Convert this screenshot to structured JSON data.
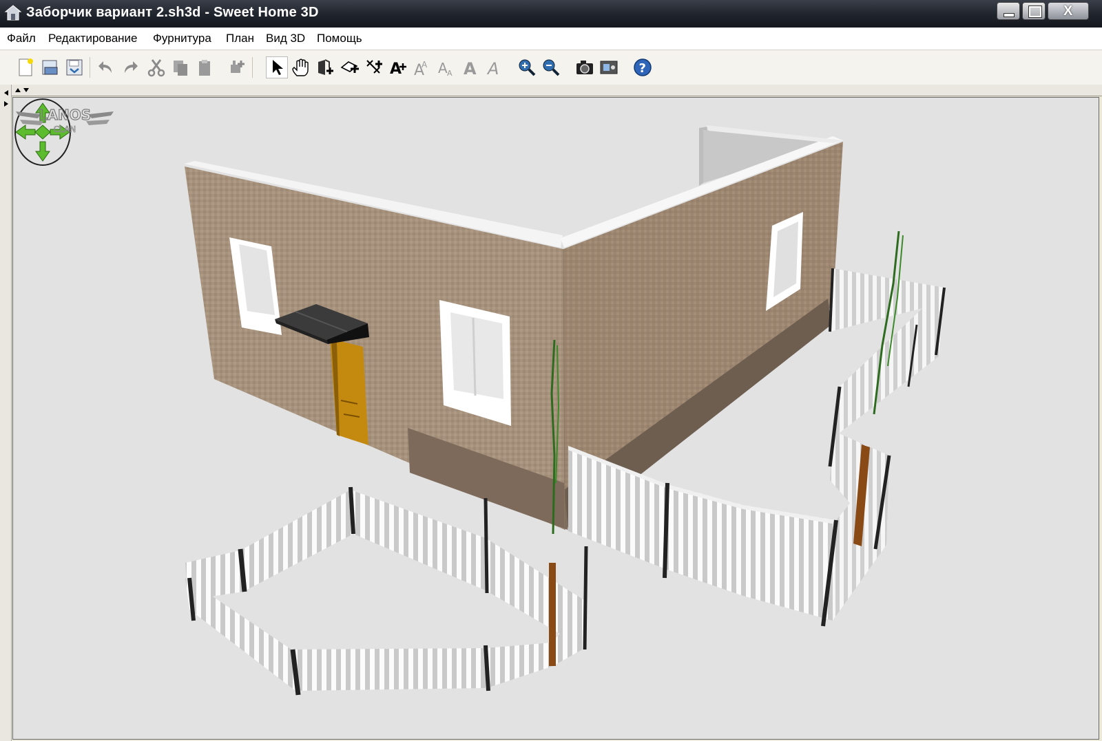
{
  "window": {
    "title": "Заборчик вариант 2.sh3d - Sweet Home 3D",
    "controls": {
      "minimize": "minimize-icon",
      "restore": "restore-icon",
      "close": "X"
    }
  },
  "menu": [
    "Файл",
    "Редактирование",
    "Фурнитура",
    "План",
    "Вид 3D",
    "Помощь"
  ],
  "toolbar": [
    "new-file-icon",
    "open-icon",
    "save-icon",
    "undo-icon",
    "redo-icon",
    "cut-icon",
    "copy-icon",
    "paste-icon",
    "add-furniture-icon",
    "select-pointer-icon",
    "pan-hand-icon",
    "create-walls-icon",
    "create-rooms-icon",
    "create-dimensions-icon",
    "add-text-icon",
    "increase-text-icon",
    "decrease-text-icon",
    "bold-text-icon",
    "italic-text-icon",
    "zoom-in-icon",
    "zoom-out-icon",
    "photo-camera-icon",
    "video-icon",
    "help-icon"
  ],
  "view3d": {
    "navigation": "navigation-arrows-icon",
    "watermark": "LANOS CLAN"
  }
}
